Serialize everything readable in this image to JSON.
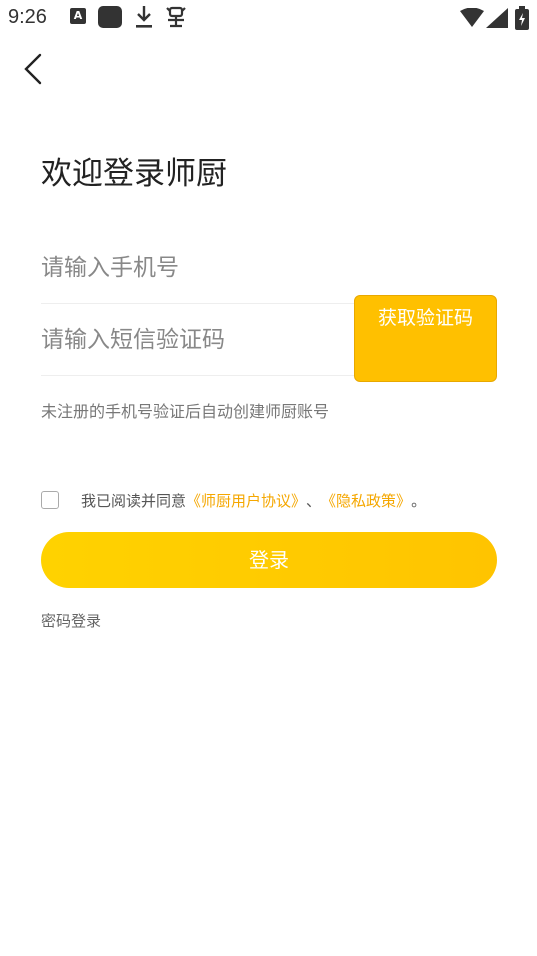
{
  "status_bar": {
    "time": "9:26",
    "notification_letter": "A",
    "icons": [
      "a-notification-icon",
      "square-notification-icon",
      "download-icon",
      "bug-icon",
      "wifi-icon",
      "signal-icon",
      "battery-icon"
    ]
  },
  "header": {
    "back_icon": "chevron-left-icon"
  },
  "title": "欢迎登录师厨",
  "phone_field": {
    "placeholder": "请输入手机号",
    "value": ""
  },
  "code_field": {
    "placeholder": "请输入短信验证码",
    "value": ""
  },
  "get_code_button": {
    "label": "获取验证码"
  },
  "hint": "未注册的手机号验证后自动创建师厨账号",
  "agreement": {
    "checked": false,
    "prefix": "我已阅读并同意",
    "user_agreement": "《师厨用户协议》",
    "separator": "、",
    "privacy_policy": "《隐私政策》",
    "suffix": "。"
  },
  "login_button": {
    "label": "登录"
  },
  "password_login": "密码登录",
  "colors": {
    "accent": "#ffc400",
    "link": "#f5a700",
    "title_text": "#222222",
    "placeholder": "#888888"
  }
}
